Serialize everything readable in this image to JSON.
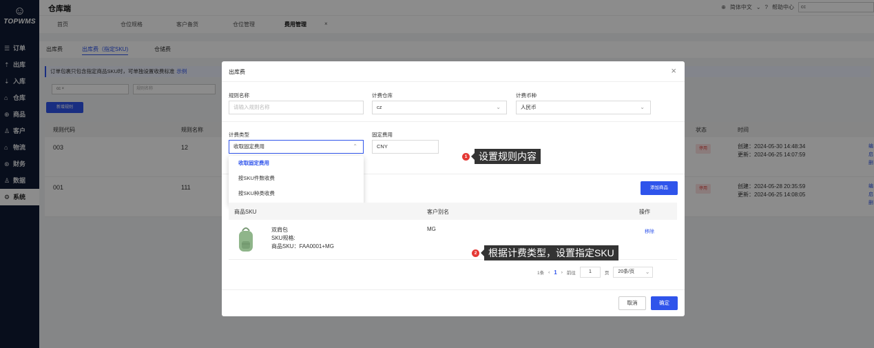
{
  "sidebar": {
    "logo_glyph": "☺",
    "brand": "TOPWMS",
    "items": [
      {
        "icon": "☰",
        "label": "订单"
      },
      {
        "icon": "⇡",
        "label": "出库"
      },
      {
        "icon": "⇣",
        "label": "入库"
      },
      {
        "icon": "⌂",
        "label": "仓库"
      },
      {
        "icon": "⊕",
        "label": "商品"
      },
      {
        "icon": "♙",
        "label": "客户"
      },
      {
        "icon": "⌂",
        "label": "物流"
      },
      {
        "icon": "⊛",
        "label": "财务"
      },
      {
        "icon": "♙",
        "label": "数据"
      },
      {
        "icon": "⚙",
        "label": "系统"
      }
    ]
  },
  "topbar": {
    "title": "仓库端",
    "language": "简体中文",
    "help": "帮助中心",
    "user": "cc"
  },
  "tabs": [
    "首页",
    "仓位规格",
    "客户备货",
    "仓位管理",
    "费用管理"
  ],
  "subtabs": [
    "出库费",
    "出库费（指定SKU)",
    "仓储费"
  ],
  "notice": {
    "text": "订单包裹只包含指定商品SKU时，可单独设置收费标准",
    "link": "示例"
  },
  "filters": {
    "chip": "cc ×",
    "name_placeholder": "规则名称"
  },
  "new_button": "新增规则",
  "table": {
    "headers": {
      "code": "规则代码",
      "name": "规则名称",
      "status": "状态",
      "time": "时间"
    },
    "rows": [
      {
        "code": "003",
        "name": "12",
        "status": "停用",
        "created": "创建：2024-05-30 14:48:34",
        "updated": "更新：2024-06-25 14:07:59",
        "actions": [
          "编",
          "启",
          "删"
        ]
      },
      {
        "code": "001",
        "name": "111",
        "status": "停用",
        "created": "创建：2024-05-28 20:35:59",
        "updated": "更新：2024-06-25 14:08:05",
        "actions": [
          "编",
          "启",
          "删"
        ]
      }
    ]
  },
  "modal": {
    "title": "出库费",
    "rule_name": {
      "label": "规则名称",
      "placeholder": "请输入规则名称"
    },
    "warehouse": {
      "label": "计费仓库",
      "value": "cz"
    },
    "currency": {
      "label": "计费币种",
      "value": "人民币"
    },
    "charge_type": {
      "label": "计费类型",
      "value": "收取固定费用",
      "options": [
        "收取固定费用",
        "按SKU件数收费",
        "按SKU种类收费"
      ]
    },
    "fixed_fee": {
      "label": "固定费用",
      "value": "CNY"
    },
    "add_goods": "添加商品",
    "sku_table": {
      "headers": {
        "sku": "商品SKU",
        "alias": "客户别名",
        "ops": "操作"
      },
      "rows": [
        {
          "name": "双肩包",
          "spec": "SKU规格:",
          "sku": "商品SKU：FAA0001+MG",
          "alias": "MG",
          "action": "移除"
        }
      ]
    },
    "pagination": {
      "total": "1条",
      "current": "1",
      "goto_label": "前往",
      "goto_value": "1",
      "page_unit": "页",
      "page_size": "20条/页"
    },
    "cancel": "取消",
    "confirm": "确定"
  },
  "callouts": [
    {
      "num": "1",
      "text": "设置规则内容"
    },
    {
      "num": "2",
      "text": "根据计费类型，设置指定SKU"
    }
  ],
  "colors": {
    "primary": "#2f54eb",
    "danger": "#e53935",
    "sidebar": "#0f1a33"
  }
}
